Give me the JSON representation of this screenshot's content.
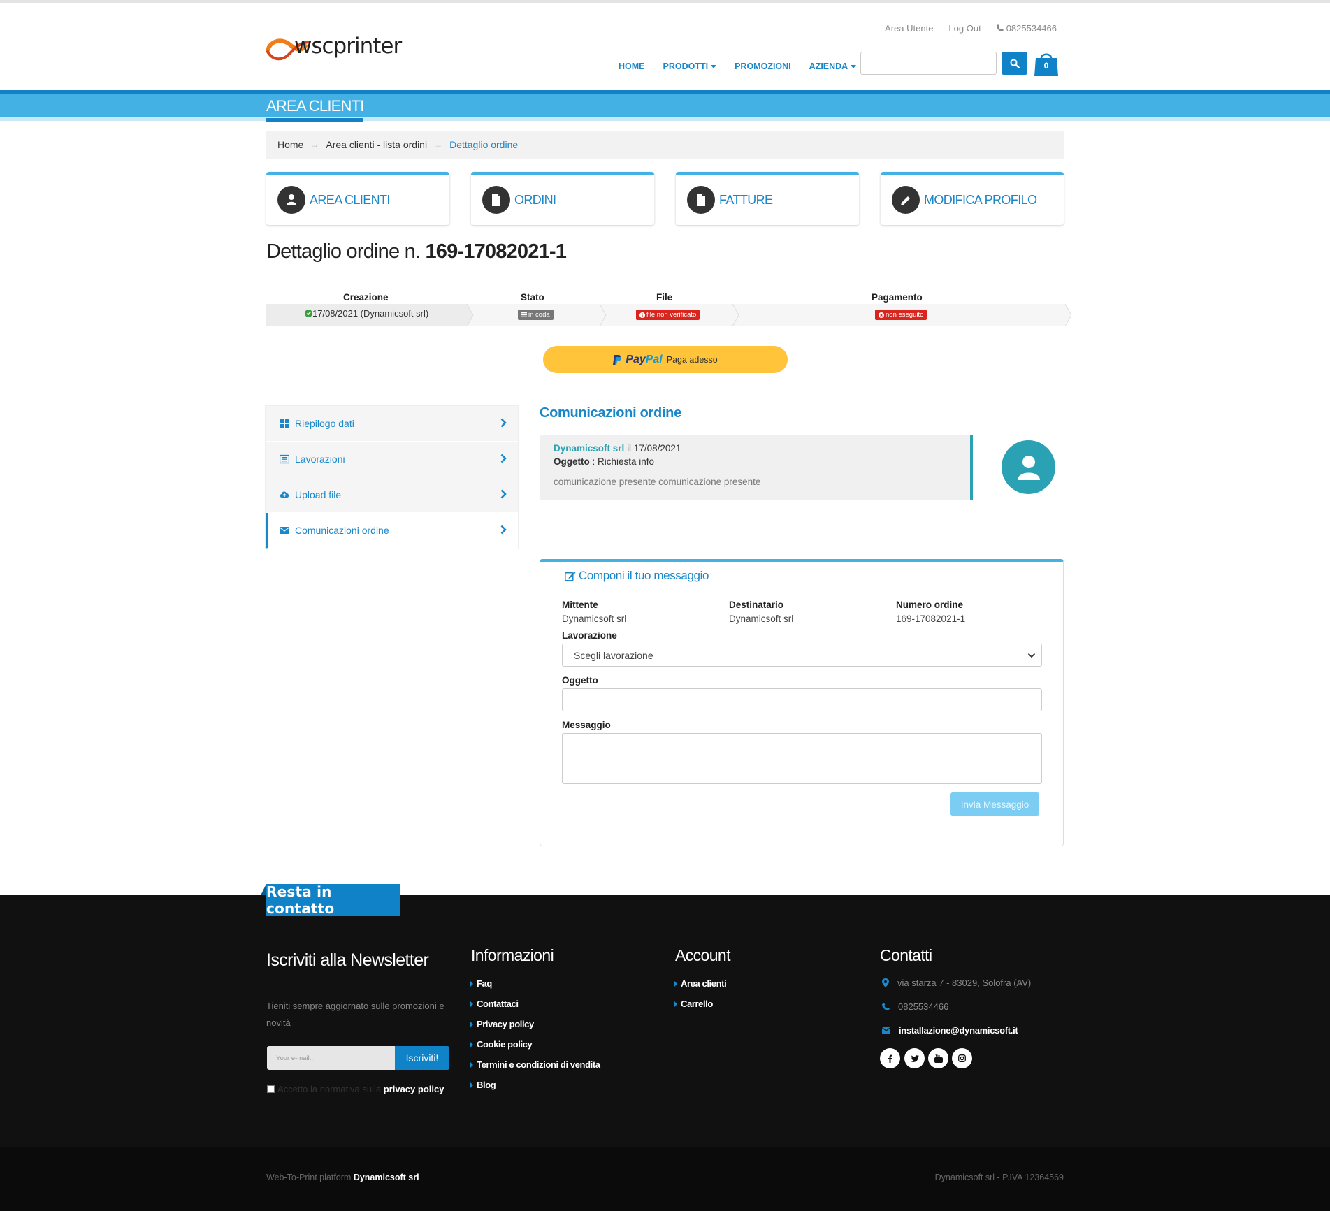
{
  "header": {
    "logo_text": "wscprinter",
    "top_links": {
      "area_utente": "Area Utente",
      "logout": "Log Out",
      "phone": "0825534466"
    },
    "nav": {
      "home": "HOME",
      "prodotti": "PRODOTTI",
      "promozioni": "PROMOZIONI",
      "azienda": "AZIENDA"
    },
    "search": {
      "value": "",
      "placeholder": ""
    },
    "cart_count": "0"
  },
  "banner": {
    "title": "AREA CLIENTI"
  },
  "breadcrumb": {
    "home": "Home",
    "list": "Area clienti - lista ordini",
    "current": "Dettaglio ordine"
  },
  "tiles": {
    "area_clienti": "AREA CLIENTI",
    "ordini": "ORDINI",
    "fatture": "FATTURE",
    "modifica_profilo": "MODIFICA PROFILO"
  },
  "order": {
    "title_prefix": "Dettaglio ordine n.",
    "number": "169-17082021-1"
  },
  "steps": {
    "creazione": {
      "label": "Creazione",
      "value": "17/08/2021 (Dynamicsoft srl)"
    },
    "stato": {
      "label": "Stato",
      "value": "in coda"
    },
    "file": {
      "label": "File",
      "value": "file non verificato"
    },
    "pagamento": {
      "label": "Pagamento",
      "value": "non eseguito"
    },
    "colors": {
      "stato": "#777777",
      "file": "#d9251d",
      "pagamento": "#d9251d",
      "ok": "#3c9d3c"
    }
  },
  "paypal": {
    "brand_a": "Pay",
    "brand_b": "Pal",
    "label": "Paga adesso"
  },
  "sidebar": {
    "items": [
      {
        "label": "Riepilogo dati"
      },
      {
        "label": "Lavorazioni"
      },
      {
        "label": "Upload file"
      },
      {
        "label": "Comunicazioni ordine"
      }
    ]
  },
  "communications": {
    "title": "Comunicazioni ordine",
    "message": {
      "author": "Dynamicsoft srl",
      "date_text": "il 17/08/2021",
      "subject_label": "Oggetto",
      "subject": ": Richiesta info",
      "body": "comunicazione presente comunicazione presente"
    }
  },
  "compose": {
    "title": "Componi il tuo messaggio",
    "mittente": {
      "label": "Mittente",
      "value": "Dynamicsoft srl"
    },
    "destinatario": {
      "label": "Destinatario",
      "value": "Dynamicsoft srl"
    },
    "numero_ordine": {
      "label": "Numero ordine",
      "value": "169-17082021-1"
    },
    "lavorazione": {
      "label": "Lavorazione",
      "selected": "Scegli lavorazione"
    },
    "oggetto": {
      "label": "Oggetto",
      "value": ""
    },
    "messaggio": {
      "label": "Messaggio",
      "value": ""
    },
    "send_label": "Invia Messaggio"
  },
  "footer": {
    "contact_tab": "Resta in contatto",
    "newsletter": {
      "title": "Iscriviti alla Newsletter",
      "text": "Tieniti sempre aggiornato sulle promozioni e novità",
      "placeholder": "Your e-mail..",
      "button": "Iscriviti!",
      "terms_prefix": "Accetto la normativa sulla ",
      "terms_link": "privacy policy"
    },
    "informazioni": {
      "title": "Informazioni",
      "links": [
        "Faq",
        "Contattaci",
        "Privacy policy",
        "Cookie policy",
        "Termini e condizioni di vendita",
        "Blog"
      ]
    },
    "account": {
      "title": "Account",
      "links": [
        "Area clienti",
        "Carrello"
      ]
    },
    "contatti": {
      "title": "Contatti",
      "address": "via starza 7 - 83029, Solofra (AV)",
      "phone": "0825534466",
      "email": "installazione@dynamicsoft.it"
    },
    "social_icons": [
      "facebook-icon",
      "twitter-icon",
      "youtube-icon",
      "instagram-icon"
    ],
    "bottom_left_prefix": "Web-To-Print platform ",
    "bottom_left_brand": "Dynamicsoft srl",
    "bottom_right": "Dynamicsoft srl - P.IVA 12364569"
  }
}
